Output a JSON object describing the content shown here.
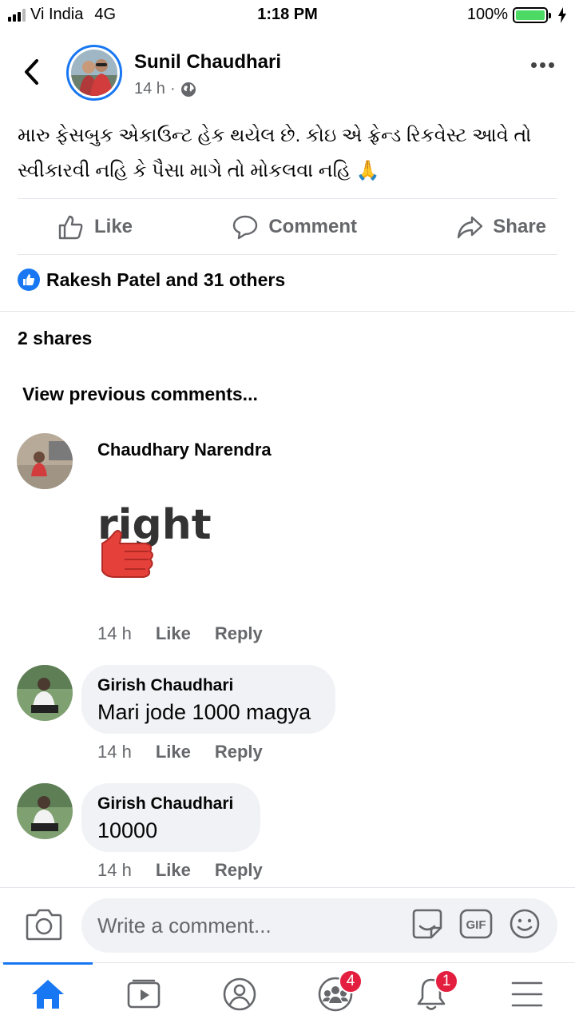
{
  "status_bar": {
    "carrier": "Vi India",
    "network": "4G",
    "time": "1:18 PM",
    "battery": "100%"
  },
  "post": {
    "author": "Sunil Chaudhari",
    "time": "14 h",
    "visibility_icon": "globe-icon",
    "text": "મારુ ફેસબુક એકાઉન્ટ હેક થયેલ છે. કોઇ એ ફ્રેન્ડ રિકવેસ્ટ આવે તો સ્વીકારવી નહિ કે પૈસા માગે તો મોકલવા નહિ 🙏"
  },
  "actions": {
    "like": "Like",
    "comment": "Comment",
    "share": "Share"
  },
  "reactions_summary": "Rakesh Patel and 31 others",
  "shares_count": "2 shares",
  "view_previous": "View previous comments...",
  "comments": [
    {
      "author": "Chaudhary Narendra",
      "sticker_text": "right",
      "time": "14 h",
      "like": "Like",
      "reply": "Reply"
    },
    {
      "author": "Girish Chaudhari",
      "text": "Mari jode 1000 magya",
      "time": "14 h",
      "like": "Like",
      "reply": "Reply"
    },
    {
      "author": "Girish Chaudhari",
      "text": "10000",
      "time": "14 h",
      "like": "Like",
      "reply": "Reply"
    }
  ],
  "composer": {
    "placeholder": "Write a comment..."
  },
  "tabs": {
    "groups_badge": "4",
    "notifications_badge": "1"
  },
  "colors": {
    "brand": "#1877f2",
    "muted": "#65676b",
    "bubble": "#f0f2f5",
    "badge": "#e41e3f"
  }
}
